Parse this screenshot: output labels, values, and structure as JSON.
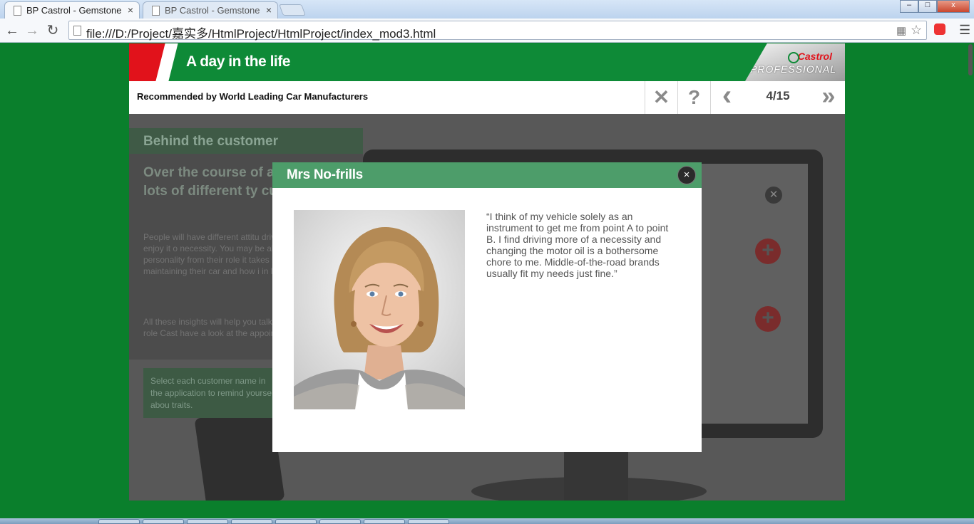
{
  "browser": {
    "tabs": [
      {
        "title": "BP Castrol - Gemstone",
        "active": true
      },
      {
        "title": "BP Castrol - Gemstone",
        "active": false
      }
    ],
    "url": "file:///D:/Project/嘉实多/HtmlProject/HtmlProject/index_mod3.html",
    "tab_close_glyph": "×",
    "window_buttons": {
      "minimize": "–",
      "maximize": "□",
      "close": "x"
    }
  },
  "app": {
    "banner_title": "A day in the life",
    "logo": {
      "brand": "Castrol",
      "line": "PROFESSIONAL"
    },
    "subtitle": "Recommended by World Leading Car Manufacturers",
    "controls": {
      "close": "✕",
      "help": "?",
      "prev": "‹",
      "next": "»"
    },
    "pager": "4/15",
    "colors": {
      "brand_green": "#0e8a37",
      "brand_red": "#e1121b",
      "modal_green": "#4d9d6a"
    }
  },
  "background_panel": {
    "heading": "Behind the customer",
    "lead": "Over the course of a wo meet lots of different ty customers.",
    "body": "People will have different attitu driving; whether they enjoy it o necessity. You may be able to into their personality from their role it takes in their life, their ap maintaining their car and how i in learning more about it.",
    "body2": "All these insights will help you talk to them about the role Cast have a look at the appointment",
    "note": "Select each customer name in the application to remind yourself abou traits."
  },
  "modal": {
    "title": "Mrs No-frills",
    "close_glyph": "×",
    "quote": "“I think of my vehicle solely as an instrument to get me from point A to point B. I find driving more of a necessity and changing the motor oil is a bothersome chore to me. Middle-of-the-road brands usually fit my needs just fine.”"
  }
}
